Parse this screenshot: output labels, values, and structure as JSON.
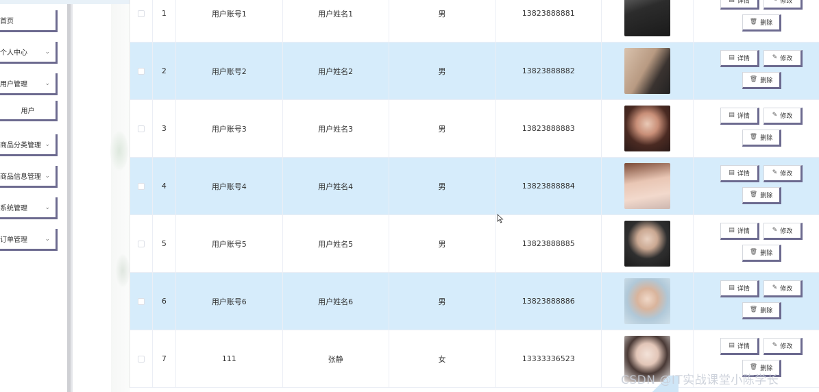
{
  "sidebar": {
    "items": [
      {
        "label": "首页",
        "has_chevron": false
      },
      {
        "label": "个人中心",
        "has_chevron": true
      },
      {
        "label": "用户管理",
        "has_chevron": true
      },
      {
        "label": "用户",
        "submenu": true
      },
      {
        "label": "商品分类管理",
        "has_chevron": true
      },
      {
        "label": "商品信息管理",
        "has_chevron": true
      },
      {
        "label": "系统管理",
        "has_chevron": true
      },
      {
        "label": "订单管理",
        "has_chevron": true
      }
    ]
  },
  "table": {
    "rows": [
      {
        "index": "1",
        "account": "用户账号1",
        "name": "用户姓名1",
        "sex": "男",
        "phone": "13823888881"
      },
      {
        "index": "2",
        "account": "用户账号2",
        "name": "用户姓名2",
        "sex": "男",
        "phone": "13823888882"
      },
      {
        "index": "3",
        "account": "用户账号3",
        "name": "用户姓名3",
        "sex": "男",
        "phone": "13823888883"
      },
      {
        "index": "4",
        "account": "用户账号4",
        "name": "用户姓名4",
        "sex": "男",
        "phone": "13823888884"
      },
      {
        "index": "5",
        "account": "用户账号5",
        "name": "用户姓名5",
        "sex": "男",
        "phone": "13823888885"
      },
      {
        "index": "6",
        "account": "用户账号6",
        "name": "用户姓名6",
        "sex": "男",
        "phone": "13823888886"
      },
      {
        "index": "7",
        "account": "111",
        "name": "张静",
        "sex": "女",
        "phone": "13333336523"
      }
    ],
    "actions": {
      "detail": "详情",
      "edit": "修改",
      "delete": "删除"
    }
  },
  "watermark": "CSDN @IT实战课堂小陈学长",
  "colors": {
    "row_alt": "#d6ecfb",
    "button_shadow": "#6c6a8f",
    "sidebar_divider": "#cfd0d4"
  },
  "icons": {
    "chevron": "chevron-down-icon",
    "detail": "document-icon",
    "edit": "pencil-icon",
    "delete": "trash-icon"
  }
}
